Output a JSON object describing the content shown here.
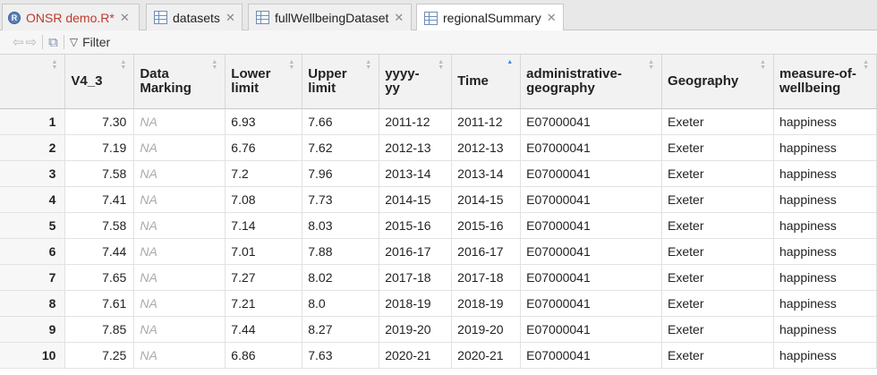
{
  "tabs": [
    {
      "label": "ONSR demo.R",
      "dirty": "*",
      "type": "r-script"
    },
    {
      "label": "datasets",
      "type": "table"
    },
    {
      "label": "fullWellbeingDataset",
      "type": "table"
    },
    {
      "label": "regionalSummary",
      "type": "table",
      "active": true
    }
  ],
  "toolbar": {
    "filter_label": "Filter"
  },
  "columns": [
    {
      "l1": "",
      "l2": ""
    },
    {
      "l1": "V4_3",
      "l2": ""
    },
    {
      "l1": "Data",
      "l2": "Marking"
    },
    {
      "l1": "Lower",
      "l2": "limit"
    },
    {
      "l1": "Upper",
      "l2": "limit"
    },
    {
      "l1": "yyyy-",
      "l2": "yy"
    },
    {
      "l1": "Time",
      "l2": ""
    },
    {
      "l1": "administrative-",
      "l2": "geography"
    },
    {
      "l1": "Geography",
      "l2": ""
    },
    {
      "l1": "measure-of-",
      "l2": "wellbeing"
    }
  ],
  "rows": [
    [
      "1",
      "7.30",
      "NA",
      "6.93",
      "7.66",
      "2011-12",
      "2011-12",
      "E07000041",
      "Exeter",
      "happiness"
    ],
    [
      "2",
      "7.19",
      "NA",
      "6.76",
      "7.62",
      "2012-13",
      "2012-13",
      "E07000041",
      "Exeter",
      "happiness"
    ],
    [
      "3",
      "7.58",
      "NA",
      "7.2",
      "7.96",
      "2013-14",
      "2013-14",
      "E07000041",
      "Exeter",
      "happiness"
    ],
    [
      "4",
      "7.41",
      "NA",
      "7.08",
      "7.73",
      "2014-15",
      "2014-15",
      "E07000041",
      "Exeter",
      "happiness"
    ],
    [
      "5",
      "7.58",
      "NA",
      "7.14",
      "8.03",
      "2015-16",
      "2015-16",
      "E07000041",
      "Exeter",
      "happiness"
    ],
    [
      "6",
      "7.44",
      "NA",
      "7.01",
      "7.88",
      "2016-17",
      "2016-17",
      "E07000041",
      "Exeter",
      "happiness"
    ],
    [
      "7",
      "7.65",
      "NA",
      "7.27",
      "8.02",
      "2017-18",
      "2017-18",
      "E07000041",
      "Exeter",
      "happiness"
    ],
    [
      "8",
      "7.61",
      "NA",
      "7.21",
      "8.0",
      "2018-19",
      "2018-19",
      "E07000041",
      "Exeter",
      "happiness"
    ],
    [
      "9",
      "7.85",
      "NA",
      "7.44",
      "8.27",
      "2019-20",
      "2019-20",
      "E07000041",
      "Exeter",
      "happiness"
    ],
    [
      "10",
      "7.25",
      "NA",
      "6.86",
      "7.63",
      "2020-21",
      "2020-21",
      "E07000041",
      "Exeter",
      "happiness"
    ]
  ]
}
